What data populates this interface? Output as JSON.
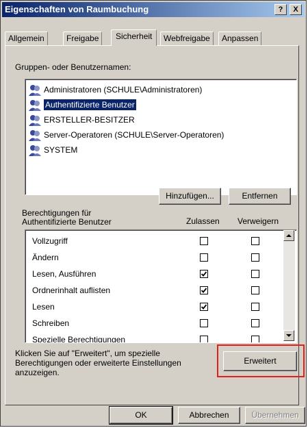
{
  "window": {
    "title": "Eigenschaften von Raumbuchung",
    "help_label": "?",
    "close_label": "X"
  },
  "tabs": [
    {
      "label": "Allgemein"
    },
    {
      "label": "Freigabe"
    },
    {
      "label": "Sicherheit"
    },
    {
      "label": "Webfreigabe"
    },
    {
      "label": "Anpassen"
    }
  ],
  "users_section": {
    "label": "Gruppen- oder Benutzernamen:",
    "items": [
      {
        "name": "Administratoren (SCHULE\\Administratoren)",
        "icon": "user-group-icon"
      },
      {
        "name": "Authentifizierte Benutzer",
        "icon": "user-group-icon"
      },
      {
        "name": "ERSTELLER-BESITZER",
        "icon": "user-group-icon"
      },
      {
        "name": "Server-Operatoren (SCHULE\\Server-Operatoren)",
        "icon": "user-group-icon"
      },
      {
        "name": "SYSTEM",
        "icon": "user-group-icon"
      }
    ],
    "selected_index": 1,
    "add_button": "Hinzufügen...",
    "remove_button": "Entfernen"
  },
  "permissions": {
    "label_line1": "Berechtigungen für",
    "label_line2": "Authentifizierte Benutzer",
    "allow_header": "Zulassen",
    "deny_header": "Verweigern",
    "rows": [
      {
        "name": "Vollzugriff",
        "allow": false,
        "deny": false
      },
      {
        "name": "Ändern",
        "allow": false,
        "deny": false
      },
      {
        "name": "Lesen, Ausführen",
        "allow": true,
        "deny": false
      },
      {
        "name": "Ordnerinhalt auflisten",
        "allow": true,
        "deny": false
      },
      {
        "name": "Lesen",
        "allow": true,
        "deny": false
      },
      {
        "name": "Schreiben",
        "allow": false,
        "deny": false
      },
      {
        "name": "Spezielle Berechtigungen",
        "allow": false,
        "deny": false
      }
    ]
  },
  "advanced": {
    "text_line1": "Klicken Sie auf \"Erweitert\", um spezielle",
    "text_line2": "Berechtigungen oder erweiterte Einstellungen",
    "text_line3": "anzuzeigen.",
    "button": "Erweitert"
  },
  "footer": {
    "ok": "OK",
    "cancel": "Abbrechen",
    "apply": "Übernehmen"
  },
  "colors": {
    "title_bar": "#0a246a",
    "selection": "#0a246a",
    "dialog_bg": "#d4d0c8",
    "highlight_box": "#e0201a"
  }
}
